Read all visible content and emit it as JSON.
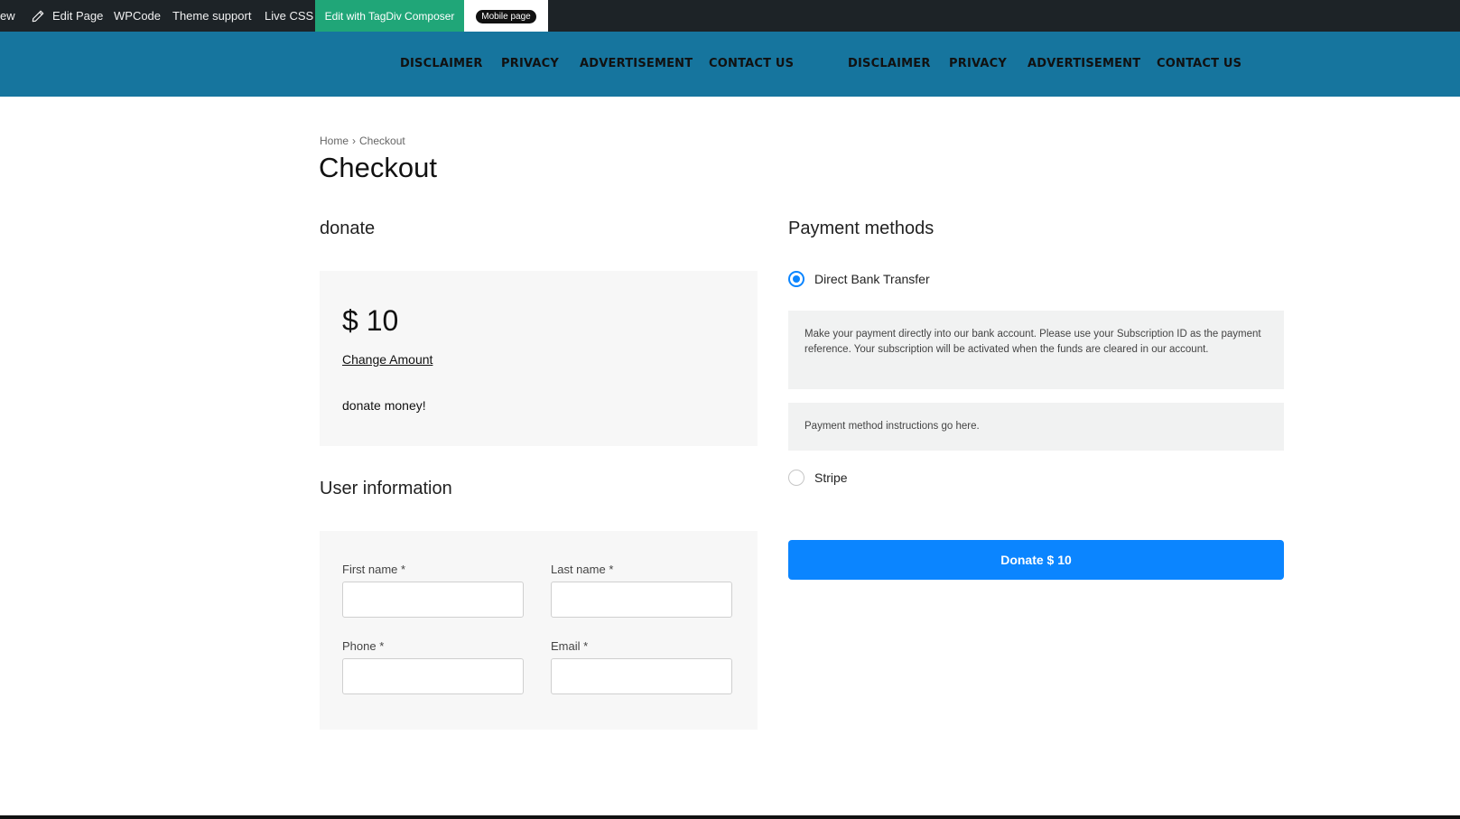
{
  "admin_bar": {
    "view_label": "ew",
    "edit_page_label": "Edit Page",
    "wpcode_label": "WPCode",
    "theme_support_label": "Theme support",
    "live_css_label": "Live CSS",
    "composer_label": "Edit with TagDiv Composer",
    "mobile_label": "Mobile page"
  },
  "nav": {
    "group1": [
      "DISCLAIMER",
      "PRIVACY",
      "ADVERTISEMENT",
      "CONTACT US"
    ],
    "group2": [
      "DISCLAIMER",
      "PRIVACY",
      "ADVERTISEMENT",
      "CONTACT US"
    ]
  },
  "breadcrumb": {
    "home": "Home",
    "separator": "›",
    "current": "Checkout"
  },
  "page_title": "Checkout",
  "donation": {
    "section_title": "donate",
    "amount": "$ 10",
    "change_amount": "Change Amount",
    "description": "donate money!"
  },
  "user_info": {
    "section_title": "User information",
    "first_name_label": "First name *",
    "last_name_label": "Last name *",
    "phone_label": "Phone *",
    "email_label": "Email *",
    "first_name_value": "",
    "last_name_value": "",
    "phone_value": "",
    "email_value": ""
  },
  "payment": {
    "section_title": "Payment methods",
    "bank_transfer_label": "Direct Bank Transfer",
    "bank_transfer_selected": true,
    "bank_transfer_description": "Make your payment directly into our bank account. Please use your Subscription ID as the payment reference. Your subscription will be activated when the funds are cleared in our account.",
    "instructions": "Payment method instructions go here.",
    "stripe_label": "Stripe",
    "stripe_selected": false,
    "donate_button": "Donate $ 10"
  },
  "colors": {
    "admin_bar_bg": "#1d2327",
    "composer_green": "#20a678",
    "nav_bg": "#16759e",
    "accent_blue": "#0b85ff",
    "panel_bg": "#f7f7f7"
  },
  "icons": {
    "edit_page": "pencil-icon"
  }
}
